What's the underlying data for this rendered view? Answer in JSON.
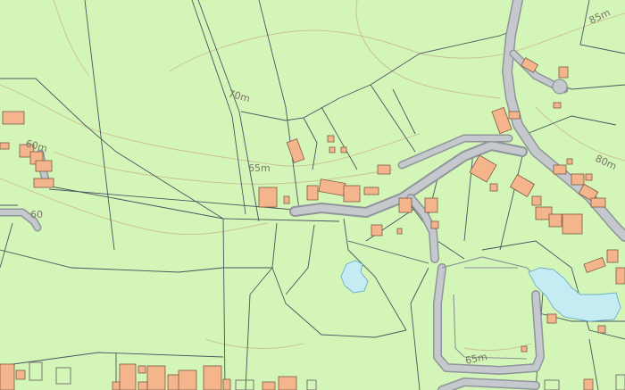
{
  "contour_labels": [
    "85m",
    "70m",
    "60m",
    "65m",
    "80m",
    "65m",
    "60"
  ],
  "colors": {
    "land": "#d4f5b8",
    "building": "#f4b58c",
    "water": "#c6ecf3",
    "road": "#c5c9cd",
    "contour": "#c9b98a",
    "boundary": "#4a5560"
  }
}
